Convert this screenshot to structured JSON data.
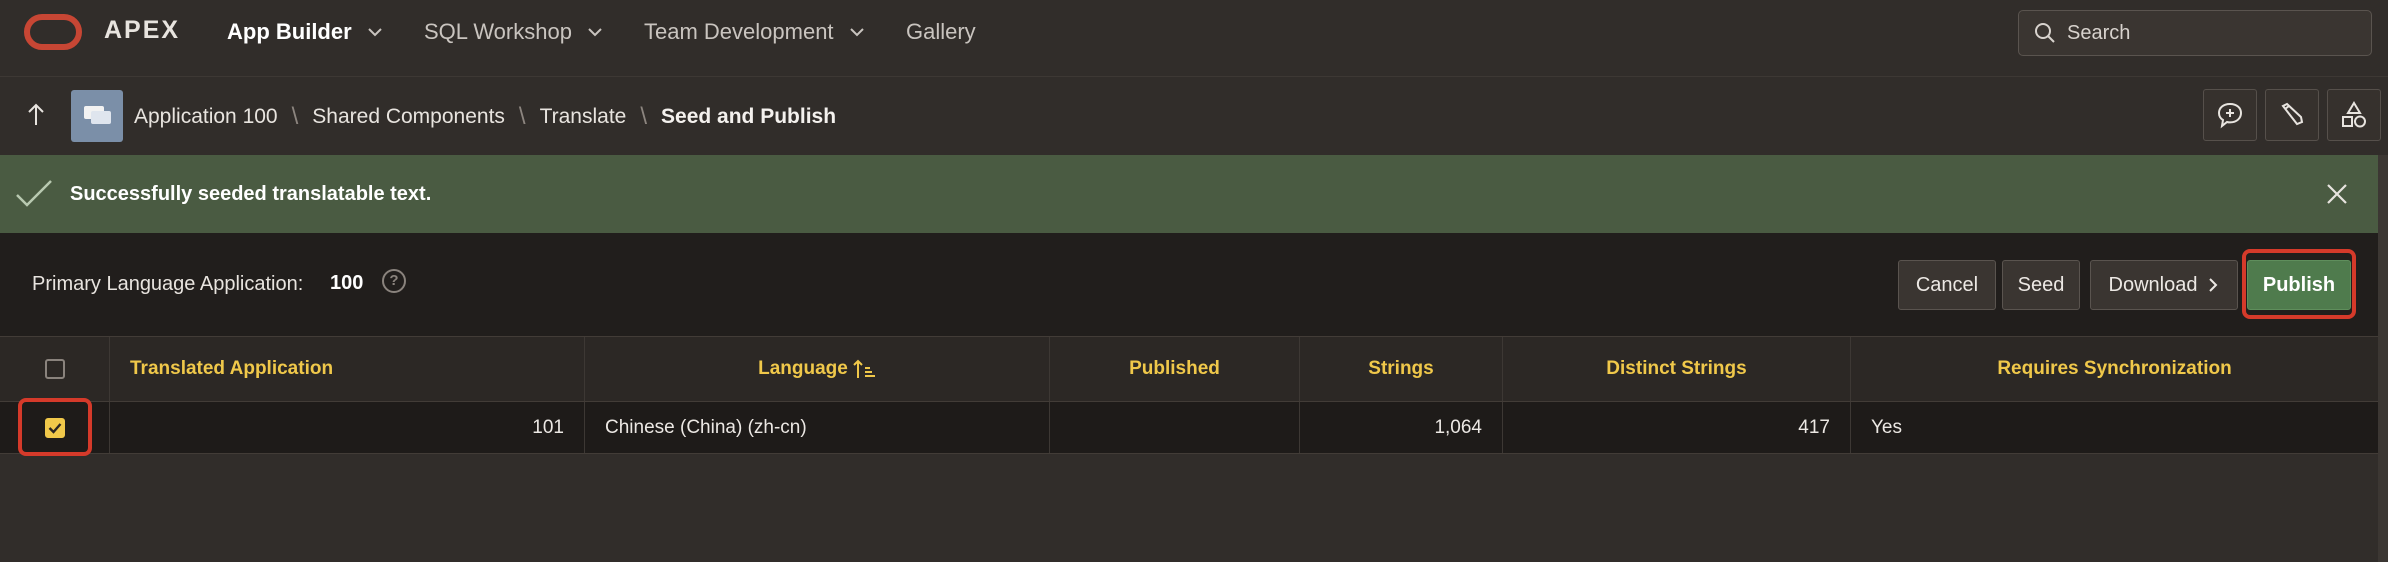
{
  "topnav": {
    "brand": "APEX",
    "items": [
      {
        "label": "App Builder",
        "has_menu": true,
        "active": true
      },
      {
        "label": "SQL Workshop",
        "has_menu": true
      },
      {
        "label": "Team Development",
        "has_menu": true
      },
      {
        "label": "Gallery",
        "has_menu": false
      }
    ],
    "search_placeholder": "Search"
  },
  "breadcrumb": {
    "items": [
      "Application 100",
      "Shared Components",
      "Translate"
    ],
    "current": "Seed and Publish"
  },
  "success": {
    "message": "Successfully seeded translatable text."
  },
  "toolbar": {
    "primary_label": "Primary Language Application:",
    "primary_value": "100",
    "help_glyph": "?",
    "buttons": {
      "cancel": "Cancel",
      "seed": "Seed",
      "download": "Download",
      "publish": "Publish"
    }
  },
  "table": {
    "columns": [
      "Translated Application",
      "Language",
      "Published",
      "Strings",
      "Distinct Strings",
      "Requires Synchronization"
    ],
    "rows": [
      {
        "selected": true,
        "translated_application": "101",
        "language": "Chinese (China) (zh-cn)",
        "published": "",
        "strings": "1,064",
        "distinct_strings": "417",
        "requires_sync": "Yes"
      }
    ]
  },
  "colors": {
    "accent_red": "#c74634",
    "success_bg": "#4a5b42",
    "header_text": "#f0c84a",
    "primary_button": "#4f7b4d"
  }
}
